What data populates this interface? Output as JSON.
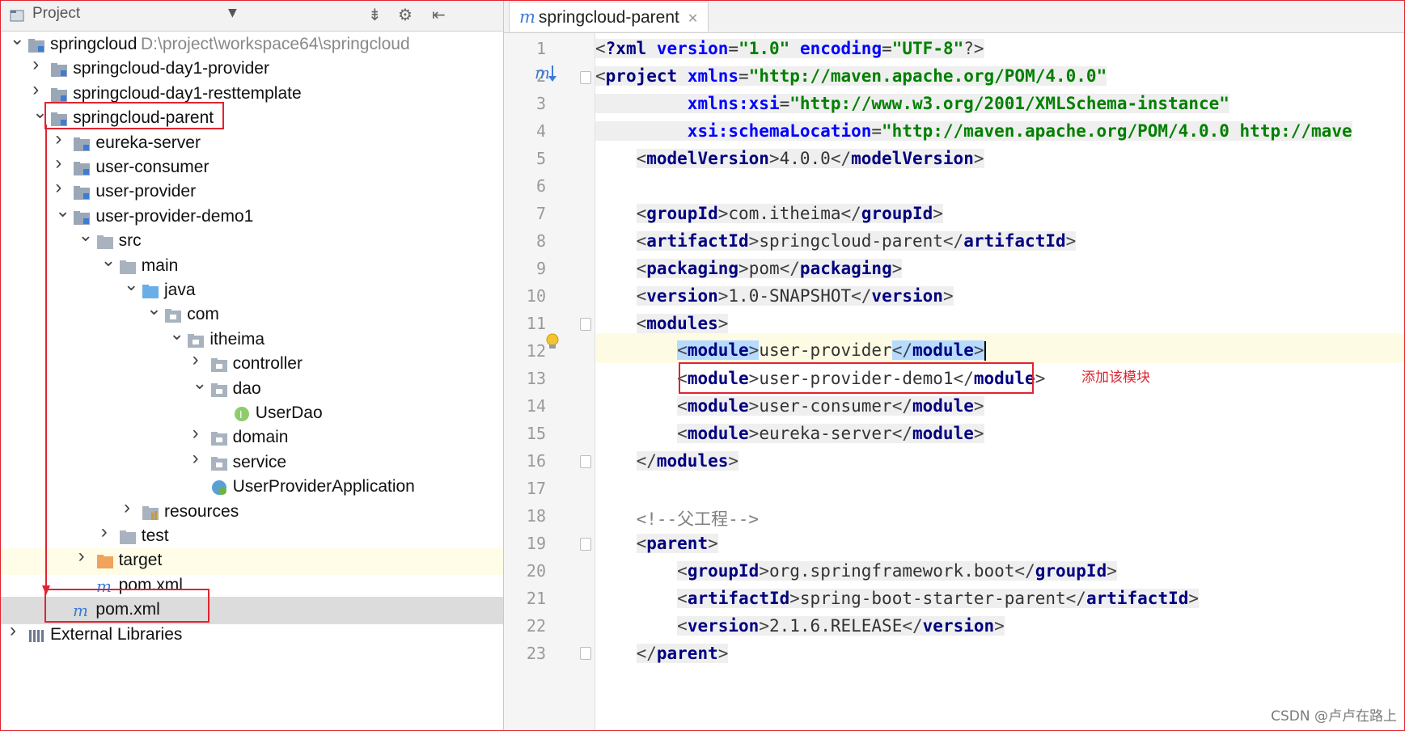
{
  "project_panel": {
    "title": "Project",
    "rows": [
      {
        "label": "springcloud",
        "path": "D:\\project\\workspace64\\springcloud",
        "level": 0,
        "icon": "module-folder-icon",
        "arrow": "down"
      },
      {
        "label": "springcloud-day1-provider",
        "level": 1,
        "icon": "module-folder-icon",
        "arrow": "right"
      },
      {
        "label": "springcloud-day1-resttemplate",
        "level": 1,
        "icon": "module-folder-icon",
        "arrow": "right"
      },
      {
        "label": "springcloud-parent",
        "level": 1,
        "icon": "module-folder-icon",
        "arrow": "down"
      },
      {
        "label": "eureka-server",
        "level": 2,
        "icon": "module-folder-icon",
        "arrow": "right"
      },
      {
        "label": "user-consumer",
        "level": 2,
        "icon": "module-folder-icon",
        "arrow": "right"
      },
      {
        "label": "user-provider",
        "level": 2,
        "icon": "module-folder-icon",
        "arrow": "right"
      },
      {
        "label": "user-provider-demo1",
        "level": 2,
        "icon": "module-folder-icon",
        "arrow": "down"
      },
      {
        "label": "src",
        "level": 3,
        "icon": "folder-icon",
        "arrow": "down"
      },
      {
        "label": "main",
        "level": 4,
        "icon": "folder-icon",
        "arrow": "down"
      },
      {
        "label": "java",
        "level": 5,
        "icon": "source-folder-icon",
        "arrow": "down"
      },
      {
        "label": "com",
        "level": 6,
        "icon": "package-icon",
        "arrow": "down"
      },
      {
        "label": "itheima",
        "level": 7,
        "icon": "package-icon",
        "arrow": "down"
      },
      {
        "label": "controller",
        "level": 8,
        "icon": "package-icon",
        "arrow": "right"
      },
      {
        "label": "dao",
        "level": 8,
        "icon": "package-icon",
        "arrow": "down"
      },
      {
        "label": "UserDao",
        "level": 9,
        "icon": "interface-icon",
        "arrow": "none"
      },
      {
        "label": "domain",
        "level": 8,
        "icon": "package-icon",
        "arrow": "right"
      },
      {
        "label": "service",
        "level": 8,
        "icon": "package-icon",
        "arrow": "right"
      },
      {
        "label": "UserProviderApplication",
        "level": 8,
        "icon": "spring-boot-class-icon",
        "arrow": "none"
      },
      {
        "label": "resources",
        "level": 5,
        "icon": "resources-folder-icon",
        "arrow": "right"
      },
      {
        "label": "test",
        "level": 4,
        "icon": "folder-icon",
        "arrow": "right"
      },
      {
        "label": "target",
        "level": 3,
        "icon": "target-folder-icon",
        "arrow": "right"
      },
      {
        "label": "pom.xml",
        "level": 3,
        "icon": "maven-icon",
        "arrow": "none"
      },
      {
        "label": "pom.xml",
        "level": 2,
        "icon": "maven-icon",
        "arrow": "none"
      },
      {
        "label": "External Libraries",
        "level": 0,
        "icon": "libraries-icon",
        "arrow": "right"
      }
    ]
  },
  "editor": {
    "tab_label": "springcloud-parent",
    "tab_icon": "m",
    "lines": [
      {
        "n": "1"
      },
      {
        "n": "2"
      },
      {
        "n": "3"
      },
      {
        "n": "4"
      },
      {
        "n": "5"
      },
      {
        "n": "6"
      },
      {
        "n": "7"
      },
      {
        "n": "8"
      },
      {
        "n": "9"
      },
      {
        "n": "10"
      },
      {
        "n": "11"
      },
      {
        "n": "12"
      },
      {
        "n": "13"
      },
      {
        "n": "14"
      },
      {
        "n": "15"
      },
      {
        "n": "16"
      },
      {
        "n": "17"
      },
      {
        "n": "18"
      },
      {
        "n": "19"
      },
      {
        "n": "20"
      },
      {
        "n": "21"
      },
      {
        "n": "22"
      },
      {
        "n": "23"
      }
    ],
    "code": {
      "l1_decl": "?xml",
      "l1_version_attr": "version",
      "l1_version_val": "\"1.0\"",
      "l1_enc_attr": "encoding",
      "l1_enc_val": "\"UTF-8\"",
      "l2_tag": "project",
      "l2_attr": "xmlns",
      "l2_val": "\"http://maven.apache.org/POM/4.0.0\"",
      "l3_attr": "xmlns:xsi",
      "l3_val": "\"http://www.w3.org/2001/XMLSchema-instance\"",
      "l4_attr": "xsi:schemaLocation",
      "l4_val": "\"http://maven.apache.org/POM/4.0.0 http://mave",
      "modelVersion_tag": "modelVersion",
      "modelVersion_val": "4.0.0",
      "groupId_tag": "groupId",
      "groupId_val": "com.itheima",
      "artifactId_tag": "artifactId",
      "artifactId_val": "springcloud-parent",
      "packaging_tag": "packaging",
      "packaging_val": "pom",
      "version_tag": "version",
      "version_val": "1.0-SNAPSHOT",
      "modules_tag": "modules",
      "module_tag": "module",
      "module1": "user-provider",
      "module2": "user-provider-demo1",
      "module3": "user-consumer",
      "module4": "eureka-server",
      "comment": "<!--父工程-->",
      "parent_tag": "parent",
      "parent_groupId_val": "org.springframework.boot",
      "parent_artifactId_val": "spring-boot-starter-parent",
      "parent_version_val": "2.1.6.RELEASE"
    },
    "annotation": "添加该模块"
  },
  "watermark": "CSDN @卢卢在路上",
  "colors": {
    "annotation_red": "#e0242f",
    "xml_tag": "#000080",
    "xml_attr": "#0000ff",
    "xml_string": "#008000",
    "maven_icon": "#3c7bd7",
    "selection": "#b7dbff"
  }
}
